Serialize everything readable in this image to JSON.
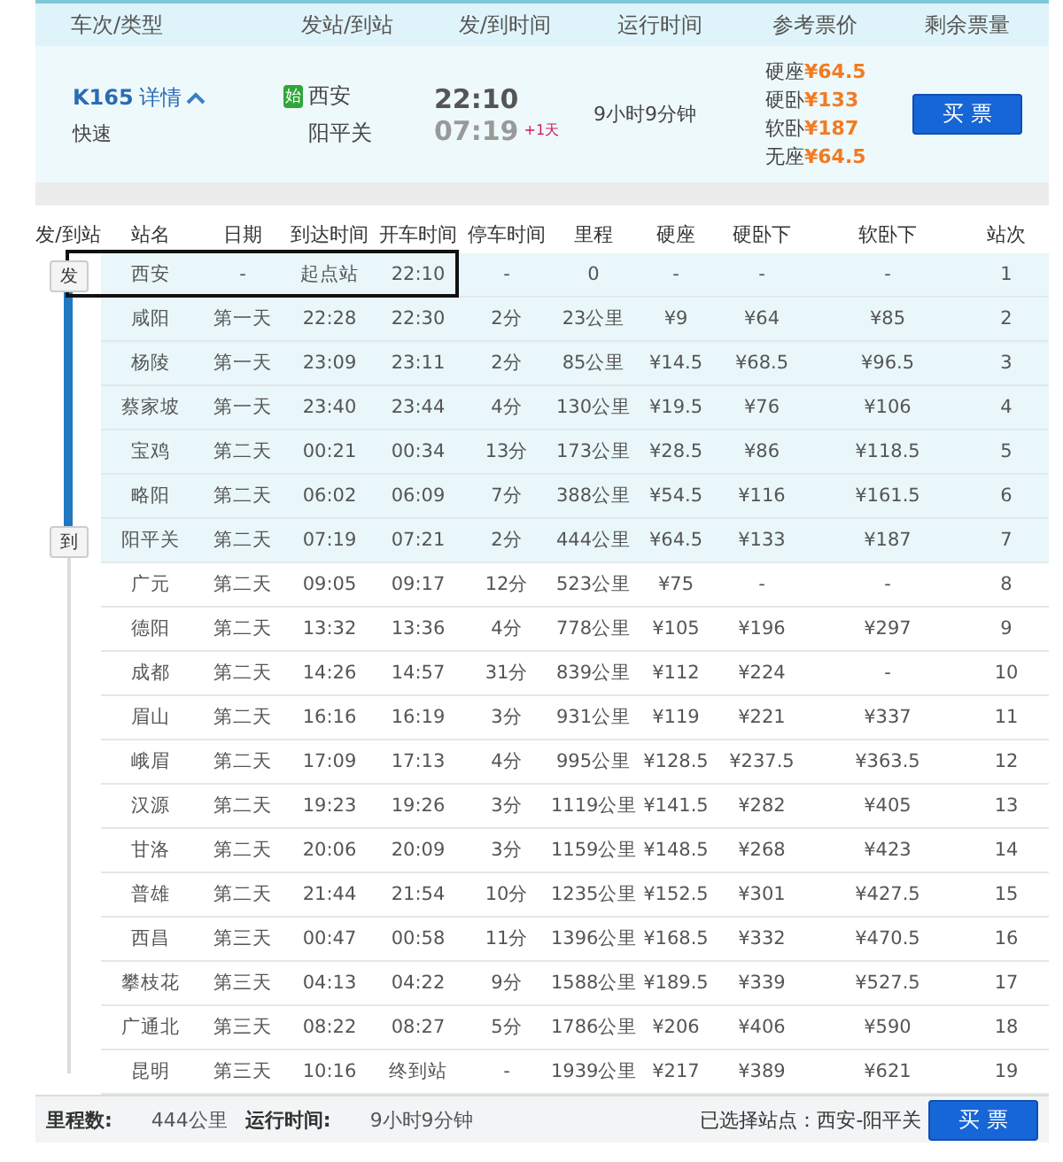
{
  "header": {
    "columns": [
      "车次/类型",
      "发站/到站",
      "发/到时间",
      "运行时间",
      "参考票价",
      "剩余票量"
    ]
  },
  "train": {
    "number": "K165",
    "details_link": "详情",
    "expanded": true,
    "type": "快速",
    "origin_badge": "始",
    "from": "西安",
    "to": "阳平关",
    "depart": "22:10",
    "arrive": "07:19",
    "day_offset": "+1天",
    "duration": "9小时9分钟",
    "prices": [
      {
        "label": "硬座",
        "price": "¥64.5"
      },
      {
        "label": "硬卧",
        "price": "¥133"
      },
      {
        "label": "软卧",
        "price": "¥187"
      },
      {
        "label": "无座",
        "price": "¥64.5"
      }
    ],
    "buy_button": "买 票"
  },
  "stops": {
    "columns": [
      "发/到站",
      "站名",
      "日期",
      "到达时间",
      "开车时间",
      "停车时间",
      "里程",
      "硬座",
      "硬卧下",
      "软卧下",
      "站次"
    ],
    "rows": [
      {
        "selected": true,
        "cells": [
          "发",
          "西安",
          "-",
          "起点站",
          "22:10",
          "-",
          "0",
          "-",
          "-",
          "-",
          "1"
        ]
      },
      {
        "selected": true,
        "cells": [
          "",
          "咸阳",
          "第一天",
          "22:28",
          "22:30",
          "2分",
          "23公里",
          "¥9",
          "¥64",
          "¥85",
          "2"
        ]
      },
      {
        "selected": true,
        "cells": [
          "",
          "杨陵",
          "第一天",
          "23:09",
          "23:11",
          "2分",
          "85公里",
          "¥14.5",
          "¥68.5",
          "¥96.5",
          "3"
        ]
      },
      {
        "selected": true,
        "cells": [
          "",
          "蔡家坡",
          "第一天",
          "23:40",
          "23:44",
          "4分",
          "130公里",
          "¥19.5",
          "¥76",
          "¥106",
          "4"
        ]
      },
      {
        "selected": true,
        "cells": [
          "",
          "宝鸡",
          "第二天",
          "00:21",
          "00:34",
          "13分",
          "173公里",
          "¥28.5",
          "¥86",
          "¥118.5",
          "5"
        ]
      },
      {
        "selected": true,
        "cells": [
          "",
          "略阳",
          "第二天",
          "06:02",
          "06:09",
          "7分",
          "388公里",
          "¥54.5",
          "¥116",
          "¥161.5",
          "6"
        ]
      },
      {
        "selected": true,
        "cells": [
          "到",
          "阳平关",
          "第二天",
          "07:19",
          "07:21",
          "2分",
          "444公里",
          "¥64.5",
          "¥133",
          "¥187",
          "7"
        ]
      },
      {
        "selected": false,
        "cells": [
          "",
          "广元",
          "第二天",
          "09:05",
          "09:17",
          "12分",
          "523公里",
          "¥75",
          "-",
          "-",
          "8"
        ]
      },
      {
        "selected": false,
        "cells": [
          "",
          "德阳",
          "第二天",
          "13:32",
          "13:36",
          "4分",
          "778公里",
          "¥105",
          "¥196",
          "¥297",
          "9"
        ]
      },
      {
        "selected": false,
        "cells": [
          "",
          "成都",
          "第二天",
          "14:26",
          "14:57",
          "31分",
          "839公里",
          "¥112",
          "¥224",
          "-",
          "10"
        ]
      },
      {
        "selected": false,
        "cells": [
          "",
          "眉山",
          "第二天",
          "16:16",
          "16:19",
          "3分",
          "931公里",
          "¥119",
          "¥221",
          "¥337",
          "11"
        ]
      },
      {
        "selected": false,
        "cells": [
          "",
          "峨眉",
          "第二天",
          "17:09",
          "17:13",
          "4分",
          "995公里",
          "¥128.5",
          "¥237.5",
          "¥363.5",
          "12"
        ]
      },
      {
        "selected": false,
        "cells": [
          "",
          "汉源",
          "第二天",
          "19:23",
          "19:26",
          "3分",
          "1119公里",
          "¥141.5",
          "¥282",
          "¥405",
          "13"
        ]
      },
      {
        "selected": false,
        "cells": [
          "",
          "甘洛",
          "第二天",
          "20:06",
          "20:09",
          "3分",
          "1159公里",
          "¥148.5",
          "¥268",
          "¥423",
          "14"
        ]
      },
      {
        "selected": false,
        "cells": [
          "",
          "普雄",
          "第二天",
          "21:44",
          "21:54",
          "10分",
          "1235公里",
          "¥152.5",
          "¥301",
          "¥427.5",
          "15"
        ]
      },
      {
        "selected": false,
        "cells": [
          "",
          "西昌",
          "第三天",
          "00:47",
          "00:58",
          "11分",
          "1396公里",
          "¥168.5",
          "¥332",
          "¥470.5",
          "16"
        ]
      },
      {
        "selected": false,
        "cells": [
          "",
          "攀枝花",
          "第三天",
          "04:13",
          "04:22",
          "9分",
          "1588公里",
          "¥189.5",
          "¥339",
          "¥527.5",
          "17"
        ]
      },
      {
        "selected": false,
        "cells": [
          "",
          "广通北",
          "第三天",
          "08:22",
          "08:27",
          "5分",
          "1786公里",
          "¥206",
          "¥406",
          "¥590",
          "18"
        ]
      },
      {
        "selected": false,
        "cells": [
          "",
          "昆明",
          "第三天",
          "10:16",
          "终到站",
          "-",
          "1939公里",
          "¥217",
          "¥389",
          "¥621",
          "19"
        ]
      }
    ]
  },
  "footer": {
    "distance_label": "里程数:",
    "distance": "444公里",
    "duration_label": "运行时间:",
    "duration": "9小时9分钟",
    "selection": "已选择站点：西安-阳平关",
    "buy_button": "买 票"
  }
}
